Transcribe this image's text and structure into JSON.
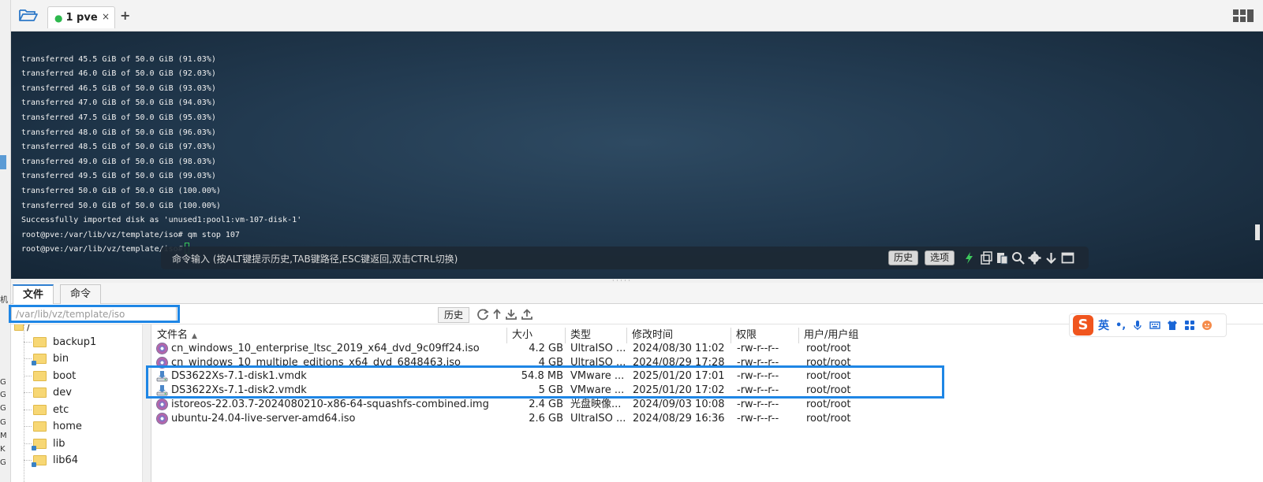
{
  "window": {
    "tab_label": "1 pve",
    "tab_close": "×",
    "tab_add": "+"
  },
  "terminal": {
    "lines": [
      "transferred 45.5 GiB of 50.0 GiB (91.03%)",
      "transferred 46.0 GiB of 50.0 GiB (92.03%)",
      "transferred 46.5 GiB of 50.0 GiB (93.03%)",
      "transferred 47.0 GiB of 50.0 GiB (94.03%)",
      "transferred 47.5 GiB of 50.0 GiB (95.03%)",
      "transferred 48.0 GiB of 50.0 GiB (96.03%)",
      "transferred 48.5 GiB of 50.0 GiB (97.03%)",
      "transferred 49.0 GiB of 50.0 GiB (98.03%)",
      "transferred 49.5 GiB of 50.0 GiB (99.03%)",
      "transferred 50.0 GiB of 50.0 GiB (100.00%)",
      "transferred 50.0 GiB of 50.0 GiB (100.00%)",
      "Successfully imported disk as 'unused1:pool1:vm-107-disk-1'",
      "root@pve:/var/lib/vz/template/iso# qm stop 107"
    ],
    "prompt": "root@pve:/var/lib/vz/template/iso#",
    "command_hint": "命令输入 (按ALT键提示历史,TAB键路径,ESC键返回,双击CTRL切换)",
    "history_button": "历史",
    "options_button": "选项"
  },
  "bottom_tabs": {
    "files": "文件",
    "commands": "命令"
  },
  "pathbar": {
    "path": "/var/lib/vz/template/iso",
    "history_button": "历史"
  },
  "tree": {
    "root": "/",
    "items": [
      "backup1",
      "bin",
      "boot",
      "dev",
      "etc",
      "home",
      "lib",
      "lib64"
    ]
  },
  "filelist": {
    "columns": [
      "文件名",
      "大小",
      "类型",
      "修改时间",
      "权限",
      "用户/用户组"
    ],
    "rows": [
      {
        "name": "cn_windows_10_enterprise_ltsc_2019_x64_dvd_9c09ff24.iso",
        "size": "4.2 GB",
        "type": "UltraISO ...",
        "mtime": "2024/08/30 11:02",
        "perm": "-rw-r--r--",
        "owner": "root/root",
        "icon": "disc-icon"
      },
      {
        "name": "cn_windows_10_multiple_editions_x64_dvd_6848463.iso",
        "size": "4 GB",
        "type": "UltraISO ...",
        "mtime": "2024/08/29 17:28",
        "perm": "-rw-r--r--",
        "owner": "root/root",
        "icon": "disc-icon"
      },
      {
        "name": "DS3622Xs-7.1-disk1.vmdk",
        "size": "54.8 MB",
        "type": "VMware ...",
        "mtime": "2025/01/20 17:01",
        "perm": "-rw-r--r--",
        "owner": "root/root",
        "icon": "disk-drive-icon"
      },
      {
        "name": "DS3622Xs-7.1-disk2.vmdk",
        "size": "5 GB",
        "type": "VMware ...",
        "mtime": "2025/01/20 17:02",
        "perm": "-rw-r--r--",
        "owner": "root/root",
        "icon": "disk-drive-icon"
      },
      {
        "name": "istoreos-22.03.7-2024080210-x86-64-squashfs-combined.img",
        "size": "2.4 GB",
        "type": "光盘映像...",
        "mtime": "2024/09/03 10:08",
        "perm": "-rw-r--r--",
        "owner": "root/root",
        "icon": "disc-icon"
      },
      {
        "name": "ubuntu-24.04-live-server-amd64.iso",
        "size": "2.6 GB",
        "type": "UltraISO ...",
        "mtime": "2024/08/29 16:36",
        "perm": "-rw-r--r--",
        "owner": "root/root",
        "icon": "disc-icon"
      }
    ]
  },
  "ime": {
    "logo": "S",
    "mode": "英",
    "punct": "•,"
  },
  "left_strip": {
    "marks": [
      "G",
      "G",
      "G",
      "G",
      "M",
      "K",
      "G"
    ],
    "mark_top": "机"
  },
  "colors": {
    "accent_highlight": "#1e86e5",
    "terminal_bg": "#223a50",
    "cursor": "#38c75a"
  }
}
